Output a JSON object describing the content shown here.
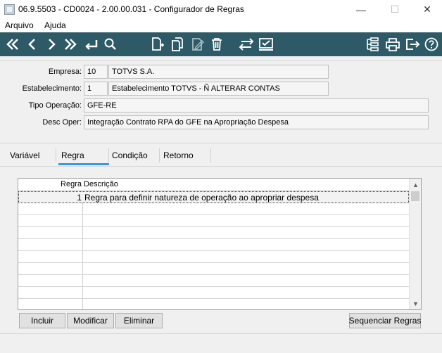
{
  "window": {
    "title": "06.9.5503 - CD0024 - 2.00.00.031 - Configurador de Regras",
    "minimize_glyph": "—",
    "maximize_glyph": "☐",
    "close_glyph": "✕"
  },
  "menu": {
    "items": [
      {
        "label": "Arquivo"
      },
      {
        "label": "Ajuda"
      }
    ]
  },
  "toolbar": {
    "background": "#2d5a66",
    "icon_color": "#ffffff",
    "buttons": [
      {
        "icon": "first-record-icon"
      },
      {
        "icon": "previous-record-icon"
      },
      {
        "icon": "next-record-icon"
      },
      {
        "icon": "last-record-icon"
      },
      {
        "icon": "goto-record-icon"
      },
      {
        "icon": "search-icon"
      },
      {
        "icon": "new-record-icon"
      },
      {
        "icon": "copy-record-icon"
      },
      {
        "icon": "edit-record-icon"
      },
      {
        "icon": "delete-record-icon"
      },
      {
        "icon": "exchange-icon"
      },
      {
        "icon": "query-icon"
      },
      {
        "icon": "navigator-icon"
      },
      {
        "icon": "print-icon"
      },
      {
        "icon": "exit-icon"
      },
      {
        "icon": "help-icon"
      }
    ]
  },
  "form": {
    "empresa": {
      "label": "Empresa:",
      "code": "10",
      "name": "TOTVS S.A."
    },
    "estabelecimento": {
      "label": "Estabelecimento:",
      "code": "1",
      "name": "Estabelecimento TOTVS - Ñ ALTERAR CONTAS"
    },
    "tipo_operacao": {
      "label": "Tipo Operação:",
      "value": "GFE-RE"
    },
    "desc_oper": {
      "label": "Desc Oper:",
      "value": "Integração Contrato RPA do GFE na Apropriação Despesa"
    }
  },
  "tabs": [
    {
      "label": "Variável",
      "active": false
    },
    {
      "label": "Regra",
      "active": true
    },
    {
      "label": "Condição",
      "active": false
    },
    {
      "label": "Retorno",
      "active": false
    }
  ],
  "accent_color": "#3a9ad9",
  "grid": {
    "columns": [
      "Regra",
      "Descrição"
    ],
    "rows": [
      {
        "regra": "1",
        "descricao": "Regra para definir natureza de operação ao apropriar despesa"
      }
    ]
  },
  "buttons": {
    "incluir": "Incluir",
    "modificar": "Modificar",
    "eliminar": "Eliminar",
    "sequenciar": "Sequenciar Regras"
  }
}
